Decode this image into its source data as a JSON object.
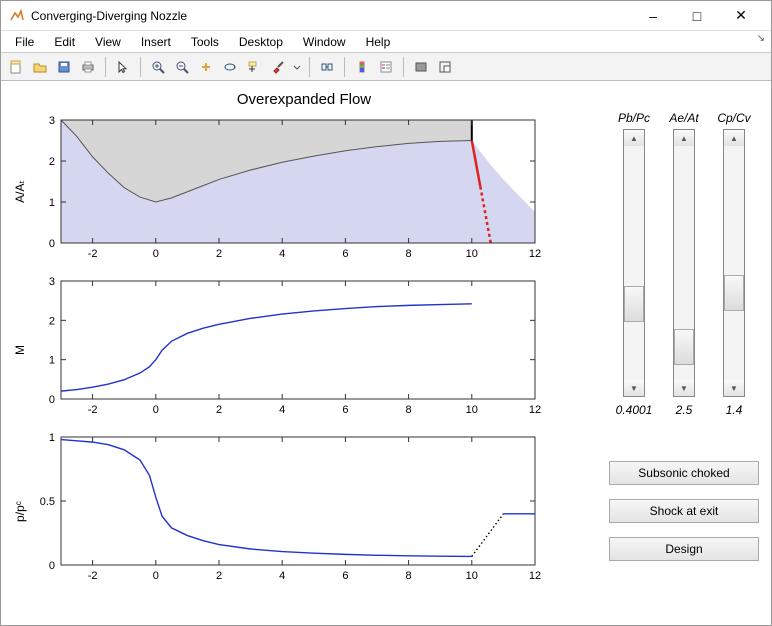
{
  "window": {
    "title": "Converging-Diverging Nozzle"
  },
  "menus": [
    "File",
    "Edit",
    "View",
    "Insert",
    "Tools",
    "Desktop",
    "Window",
    "Help"
  ],
  "toolbar_icons": [
    "new-file-icon",
    "open-file-icon",
    "save-icon",
    "print-icon",
    "|",
    "pointer-icon",
    "|",
    "zoom-in-icon",
    "zoom-out-icon",
    "pan-icon",
    "rotate-icon",
    "data-cursor-icon",
    "brush-icon",
    "dropdown-icon",
    "|",
    "link-icon",
    "|",
    "insert-colorbar-icon",
    "insert-legend-icon",
    "|",
    "hide-plot-icon",
    "dock-icon"
  ],
  "plot": {
    "title": "Overexpanded Flow",
    "charts": [
      {
        "ylabel": "A/Aₜ"
      },
      {
        "ylabel": "M"
      },
      {
        "ylabel": "p/pᶜ"
      }
    ],
    "xticks": [
      "-2",
      "0",
      "2",
      "4",
      "6",
      "8",
      "10",
      "12"
    ]
  },
  "sliders": [
    {
      "name": "pbpc",
      "label": "Pb/Pc",
      "value": "0.4001",
      "thumb_pct": 60
    },
    {
      "name": "aeat",
      "label": "Ae/At",
      "value": "2.5",
      "thumb_pct": 78
    },
    {
      "name": "cpcv",
      "label": "Cp/Cv",
      "value": "1.4",
      "thumb_pct": 55
    }
  ],
  "buttons": [
    {
      "id": "subsonic-choked",
      "label": "Subsonic choked"
    },
    {
      "id": "shock-at-exit",
      "label": "Shock at exit"
    },
    {
      "id": "design",
      "label": "Design"
    }
  ],
  "chart_data": [
    {
      "type": "line",
      "title": "Overexpanded Flow",
      "xlabel": "",
      "ylabel": "A/A_t",
      "xlim": [
        -3,
        12
      ],
      "ylim": [
        0,
        3
      ],
      "xticks": [
        -2,
        0,
        2,
        4,
        6,
        8,
        10,
        12
      ],
      "yticks": [
        0,
        1,
        2,
        3
      ],
      "series": [
        {
          "name": "nozzle upper wall (A/A_t)",
          "color": "#b5b5b5",
          "x": [
            -3.0,
            -2.5,
            -2.0,
            -1.5,
            -1.0,
            -0.5,
            0.0,
            0.5,
            1.0,
            1.5,
            2.0,
            3.0,
            4.0,
            5.0,
            6.0,
            7.0,
            8.0,
            9.0,
            10.0
          ],
          "values": [
            3.0,
            2.6,
            2.1,
            1.7,
            1.35,
            1.12,
            1.0,
            1.1,
            1.25,
            1.4,
            1.55,
            1.78,
            1.97,
            2.12,
            2.25,
            2.35,
            2.43,
            2.48,
            2.5
          ]
        }
      ],
      "annotations": [
        {
          "name": "plume upper edge",
          "type": "area",
          "color": "#c9caf0",
          "x": [
            -3,
            10,
            10.3,
            10.6,
            11.0,
            11.5,
            12,
            12,
            -3
          ],
          "y": [
            3.0,
            2.5,
            2.2,
            1.9,
            1.55,
            1.15,
            0.75,
            0,
            0
          ]
        },
        {
          "name": "exit plane",
          "type": "line",
          "color": "#000",
          "x": [
            10,
            10
          ],
          "y": [
            2.5,
            3.0
          ]
        },
        {
          "name": "oblique shock",
          "type": "line",
          "color": "#d22",
          "x": [
            10.0,
            10.6
          ],
          "y": [
            2.5,
            0.0
          ],
          "style": "solid-then-dashed"
        }
      ]
    },
    {
      "type": "line",
      "xlabel": "",
      "ylabel": "M",
      "xlim": [
        -3,
        12
      ],
      "ylim": [
        0,
        3
      ],
      "xticks": [
        -2,
        0,
        2,
        4,
        6,
        8,
        10,
        12
      ],
      "yticks": [
        0,
        1,
        2,
        3
      ],
      "series": [
        {
          "name": "Mach number",
          "color": "#2233cc",
          "x": [
            -3.0,
            -2.5,
            -2.0,
            -1.5,
            -1.0,
            -0.5,
            -0.2,
            0.0,
            0.2,
            0.5,
            1.0,
            1.5,
            2.0,
            3.0,
            4.0,
            5.0,
            6.0,
            7.0,
            8.0,
            9.0,
            10.0
          ],
          "values": [
            0.2,
            0.24,
            0.3,
            0.38,
            0.49,
            0.66,
            0.82,
            1.0,
            1.24,
            1.47,
            1.67,
            1.8,
            1.9,
            2.05,
            2.16,
            2.24,
            2.3,
            2.35,
            2.38,
            2.4,
            2.42
          ]
        }
      ]
    },
    {
      "type": "line",
      "xlabel": "",
      "ylabel": "p/p_c",
      "xlim": [
        -3,
        12
      ],
      "ylim": [
        0,
        1
      ],
      "xticks": [
        -2,
        0,
        2,
        4,
        6,
        8,
        10,
        12
      ],
      "yticks": [
        0,
        0.5,
        1
      ],
      "series": [
        {
          "name": "pressure ratio",
          "color": "#2233cc",
          "x": [
            -3.0,
            -2.5,
            -2.0,
            -1.5,
            -1.0,
            -0.5,
            -0.2,
            0.0,
            0.2,
            0.5,
            1.0,
            1.5,
            2.0,
            3.0,
            4.0,
            5.0,
            6.0,
            7.0,
            8.0,
            9.0,
            10.0
          ],
          "values": [
            0.98,
            0.97,
            0.96,
            0.94,
            0.9,
            0.82,
            0.7,
            0.53,
            0.38,
            0.29,
            0.23,
            0.19,
            0.16,
            0.125,
            0.105,
            0.092,
            0.083,
            0.076,
            0.072,
            0.069,
            0.067
          ]
        },
        {
          "name": "back-pressure (dotted → solid)",
          "color": "#000",
          "style": "dotted",
          "x": [
            10.0,
            11.0
          ],
          "values": [
            0.067,
            0.4
          ]
        },
        {
          "name": "back-pressure flat",
          "color": "#2233cc",
          "x": [
            11.0,
            12.0
          ],
          "values": [
            0.4,
            0.4
          ]
        }
      ]
    }
  ]
}
